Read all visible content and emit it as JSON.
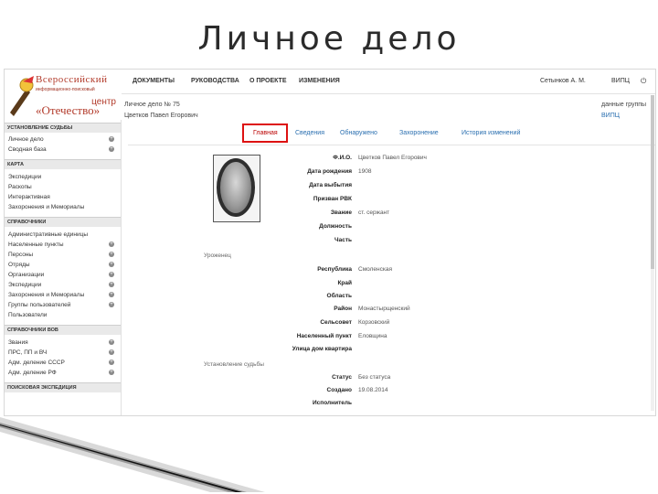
{
  "slide": {
    "title": "Личное дело"
  },
  "logo": {
    "line1": "Всероссийский",
    "line2": "информационно-поисковый",
    "line3": "центр",
    "line4": "«Отечество»"
  },
  "topnav": {
    "items": [
      "ДОКУМЕНТЫ",
      "РУКОВОДСТВА",
      "О ПРОЕКТЕ",
      "ИЗМЕНЕНИЯ"
    ],
    "user": "Сетынков А. М.",
    "user_org": "ВИПЦ",
    "power": "⏻"
  },
  "sidebar": {
    "sections": [
      {
        "title": "УСТАНОВЛЕНИЕ СУДЬБЫ",
        "items": [
          {
            "label": "Личное дело",
            "plus": true
          },
          {
            "label": "Сводная база",
            "plus": true
          }
        ]
      },
      {
        "title": "КАРТА",
        "items": [
          {
            "label": "Экспедиции",
            "plus": false
          },
          {
            "label": "Раскопы",
            "plus": false
          },
          {
            "label": "Интерактивная",
            "plus": false
          },
          {
            "label": "Захоронения и Мемориалы",
            "plus": false
          }
        ]
      },
      {
        "title": "СПРАВОЧНИКИ",
        "items": [
          {
            "label": "Административные единицы",
            "plus": false
          },
          {
            "label": "Населенные пункты",
            "plus": true
          },
          {
            "label": "Персоны",
            "plus": true
          },
          {
            "label": "Отряды",
            "plus": true
          },
          {
            "label": "Организации",
            "plus": true
          },
          {
            "label": "Экспедиции",
            "plus": true
          },
          {
            "label": "Захоронения и Мемориалы",
            "plus": true
          },
          {
            "label": "Группы пользователей",
            "plus": true
          },
          {
            "label": "Пользователи",
            "plus": false
          }
        ]
      },
      {
        "title": "СПРАВОЧНИКИ ВОВ",
        "items": [
          {
            "label": "Звания",
            "plus": true
          },
          {
            "label": "ПРС, ПП и ВЧ",
            "plus": true
          },
          {
            "label": "Адм. деление СССР",
            "plus": true
          },
          {
            "label": "Адм. деление РФ",
            "plus": true
          }
        ]
      },
      {
        "title": "ПОИСКОВАЯ ЭКСПЕДИЦИЯ",
        "items": []
      }
    ]
  },
  "record": {
    "number": "Личное дело № 75",
    "name": "Цветков Павел Егорович",
    "data_group_label": "данные группы",
    "data_group_value": "ВИПЦ"
  },
  "tabs": [
    "Главная",
    "Сведения",
    "Обнаружено",
    "Захоронение",
    "История изменений"
  ],
  "active_tab": 0,
  "fields_personal": [
    {
      "label": "Ф.И.О.",
      "value": "Цветков Павел Егорович"
    },
    {
      "label": "Дата рождения",
      "value": "1908"
    },
    {
      "label": "Дата выбытия",
      "value": ""
    },
    {
      "label": "Призван РВК",
      "value": ""
    },
    {
      "label": "Звание",
      "value": "ст. сержант"
    },
    {
      "label": "Должность",
      "value": ""
    },
    {
      "label": "Часть",
      "value": ""
    }
  ],
  "group_origin": "Уроженец",
  "fields_origin": [
    {
      "label": "Республика",
      "value": "Смоленская"
    },
    {
      "label": "Край",
      "value": ""
    },
    {
      "label": "Область",
      "value": ""
    },
    {
      "label": "Район",
      "value": "Монастырщенский"
    },
    {
      "label": "Сельсовет",
      "value": "Корзовский"
    },
    {
      "label": "Населенный пункт",
      "value": "Еловщина"
    },
    {
      "label": "Улица дом квартира",
      "value": ""
    }
  ],
  "group_fate": "Установление судьбы",
  "fields_fate": [
    {
      "label": "Статус",
      "value": "Без статуса"
    },
    {
      "label": "Создано",
      "value": "19.08.2014"
    },
    {
      "label": "Исполнитель",
      "value": ""
    }
  ]
}
